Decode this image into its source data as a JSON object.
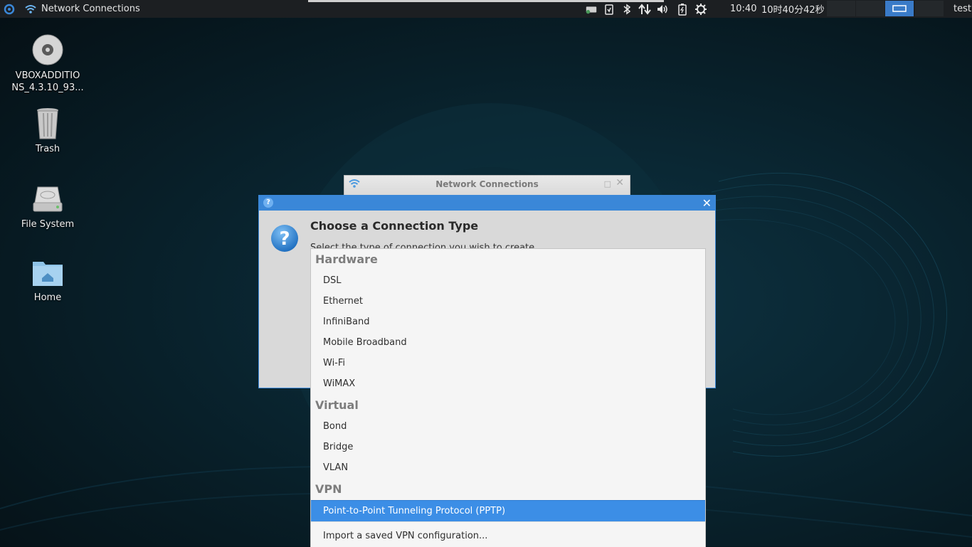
{
  "panel": {
    "window_title": "Network Connections",
    "clock_short": "10:40",
    "clock_full": "10时40分42秒",
    "user": "test"
  },
  "desktop": {
    "icons": [
      {
        "label_line1": "VBOXADDITIO",
        "label_line2": "NS_4.3.10_93..."
      },
      {
        "label": "Trash"
      },
      {
        "label": "File System"
      },
      {
        "label": "Home"
      }
    ]
  },
  "back_window": {
    "title": "Network Connections"
  },
  "dialog": {
    "heading": "Choose a Connection Type",
    "subtitle": "Select the type of connection you wish to create."
  },
  "list": {
    "groups": {
      "hardware": "Hardware",
      "virtual": "Virtual",
      "vpn": "VPN"
    },
    "hardware_items": [
      "DSL",
      "Ethernet",
      "InfiniBand",
      "Mobile Broadband",
      "Wi-Fi",
      "WiMAX"
    ],
    "virtual_items": [
      "Bond",
      "Bridge",
      "VLAN"
    ],
    "vpn_items": [
      "Point-to-Point Tunneling Protocol (PPTP)"
    ],
    "import": "Import a saved VPN configuration..."
  },
  "colors": {
    "accent": "#3a87d8",
    "selection": "#3c8ee6",
    "panel": "#1c1f22"
  }
}
